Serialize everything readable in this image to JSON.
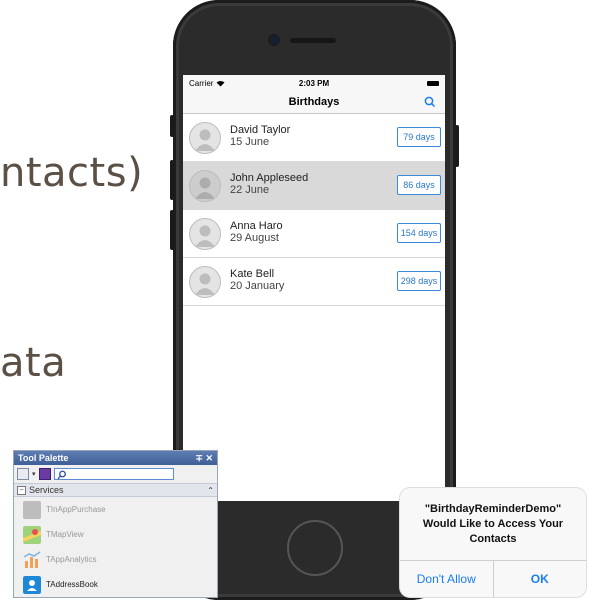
{
  "slide": {
    "line1": "ntacts)",
    "line2": "ata"
  },
  "phone": {
    "status": {
      "carrier": "Carrier",
      "time": "2:03 PM"
    },
    "nav": {
      "title": "Birthdays",
      "search_icon": "search-icon"
    },
    "contacts": [
      {
        "name": "David Taylor",
        "date": "15 June",
        "days": "79 days",
        "selected": false
      },
      {
        "name": "John Appleseed",
        "date": "22 June",
        "days": "86 days",
        "selected": true
      },
      {
        "name": "Anna Haro",
        "date": "29 August",
        "days": "154 days",
        "selected": false
      },
      {
        "name": "Kate Bell",
        "date": "20 January",
        "days": "298 days",
        "selected": false
      }
    ]
  },
  "palette": {
    "title": "Tool Palette",
    "controls": "∓ ✕",
    "category": "Services",
    "items": [
      {
        "label": "TInAppPurchase",
        "icon": "cart-icon",
        "active": false
      },
      {
        "label": "TMapView",
        "icon": "map-icon",
        "active": false
      },
      {
        "label": "TAppAnalytics",
        "icon": "analytics-icon",
        "active": false
      },
      {
        "label": "TAddressBook",
        "icon": "address-book-icon",
        "active": true
      }
    ]
  },
  "alert": {
    "line1": "\"BirthdayReminderDemo\"",
    "line2": "Would Like to Access Your",
    "line3": "Contacts",
    "deny_label": "Don't Allow",
    "ok_label": "OK"
  },
  "colors": {
    "accent": "#1a7ff0",
    "badge": "#2a78c9",
    "slide_text": "#5b5046"
  }
}
